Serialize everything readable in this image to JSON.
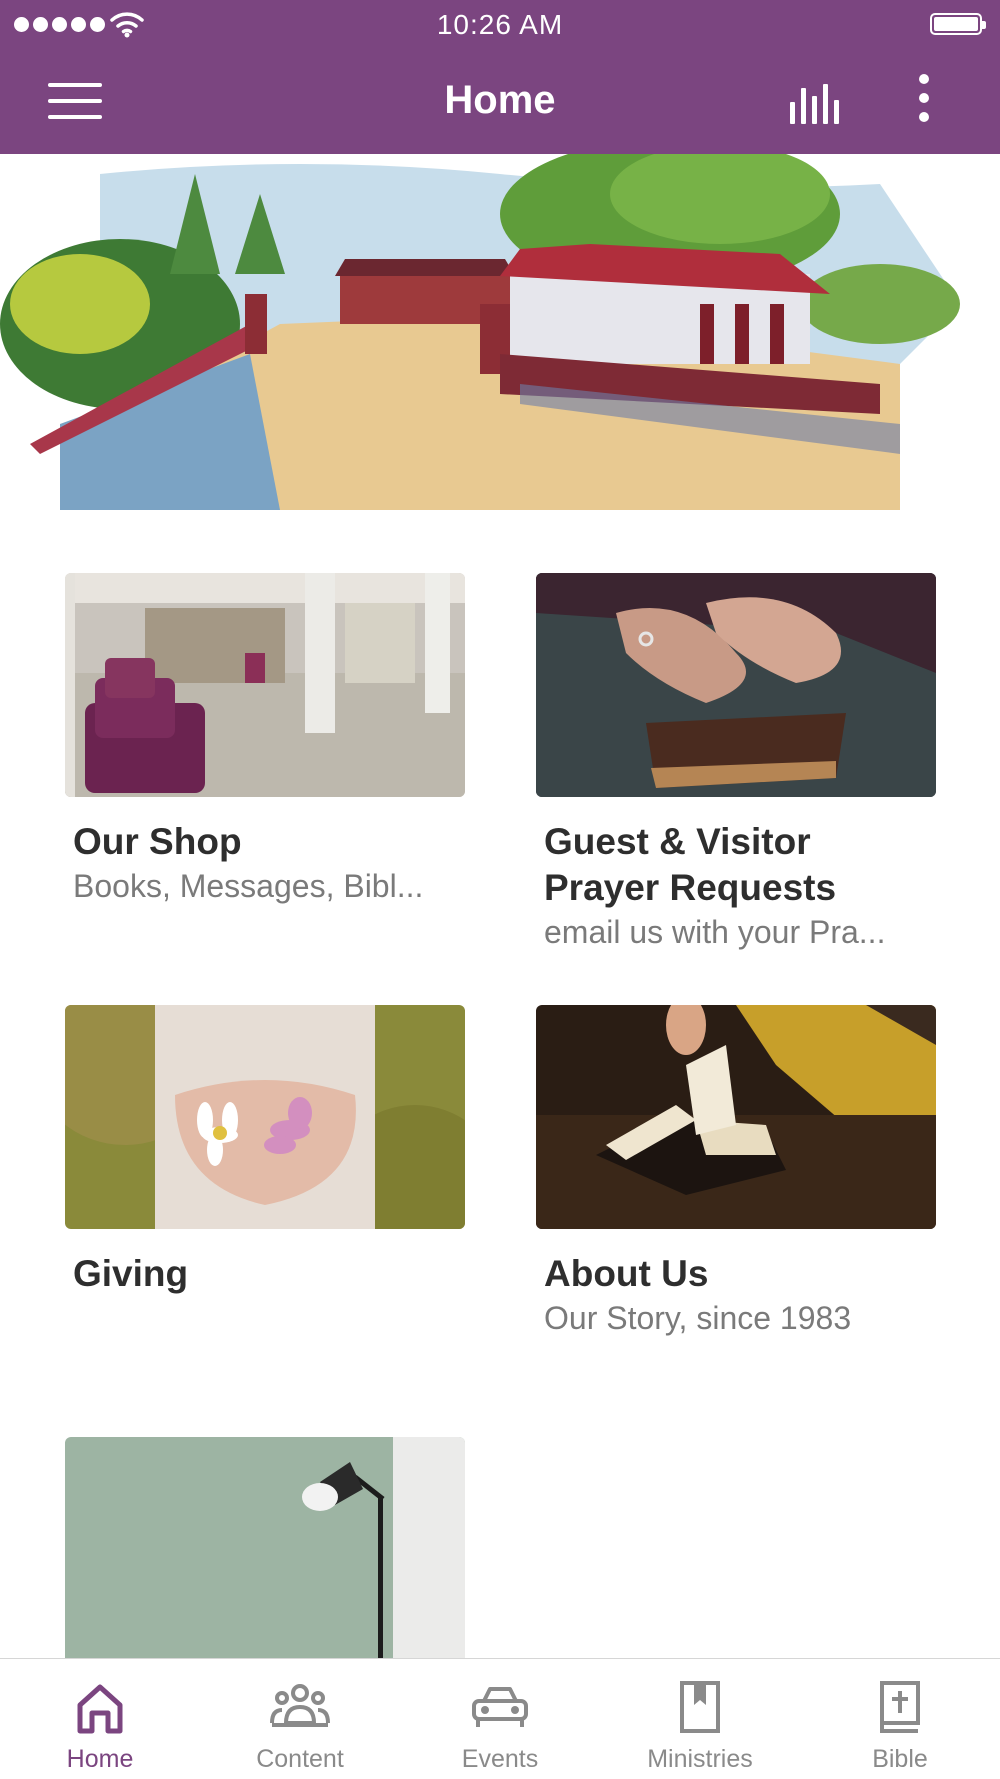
{
  "status_bar": {
    "time": "10:26 AM",
    "signal_bars": 5,
    "battery_level": 1.0
  },
  "nav": {
    "title": "Home",
    "icons": {
      "menu": "hamburger-menu-icon",
      "stats": "bar-chart-icon",
      "more": "vertical-ellipsis-icon"
    }
  },
  "hero": {
    "image": "watercolor-church-building-illustration"
  },
  "cards": [
    {
      "title": "Our Shop",
      "subtitle": "Books, Messages, Bibl...",
      "image": "shop-interior-photo"
    },
    {
      "title": "Guest & Visitor\nPrayer Requests",
      "subtitle": "email us with your Pra...",
      "image": "hands-on-bible-photo"
    },
    {
      "title": "Giving",
      "subtitle": "",
      "image": "hands-holding-flowers-photo"
    },
    {
      "title": "About Us",
      "subtitle": "Our Story, since 1983",
      "image": "open-bible-on-table-photo"
    },
    {
      "title": "",
      "subtitle": "",
      "image": "floor-lamp-against-wall-photo"
    }
  ],
  "tabs": [
    {
      "label": "Home",
      "icon": "house-icon",
      "active": true
    },
    {
      "label": "Content",
      "icon": "group-people-icon",
      "active": false
    },
    {
      "label": "Events",
      "icon": "car-icon",
      "active": false
    },
    {
      "label": "Ministries",
      "icon": "bookmark-book-icon",
      "active": false
    },
    {
      "label": "Bible",
      "icon": "bible-cross-icon",
      "active": false
    }
  ],
  "colors": {
    "brand": "#7b4580",
    "tab_inactive": "#8a8a8a",
    "text_primary": "#2e2e2e",
    "text_secondary": "#7a7a7a"
  }
}
